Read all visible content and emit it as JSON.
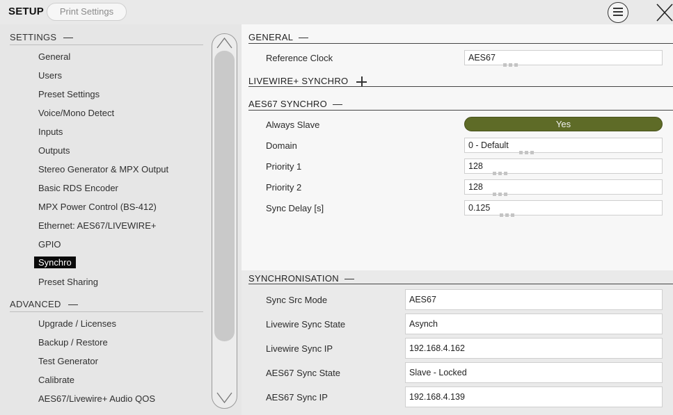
{
  "topbar": {
    "title": "SETUP",
    "print_label": "Print Settings",
    "icons": [
      "menu-icon",
      "close-icon"
    ]
  },
  "sidebar": {
    "settings_header": "SETTINGS",
    "settings_items": [
      "General",
      "Users",
      "Preset Settings",
      "Voice/Mono Detect",
      "Inputs",
      "Outputs",
      "Stereo Generator & MPX Output",
      "Basic RDS Encoder",
      "MPX Power Control (BS-412)",
      "Ethernet: AES67/LIVEWIRE+",
      "GPIO",
      "Synchro",
      "Preset Sharing"
    ],
    "active_item": "Synchro",
    "advanced_header": "ADVANCED",
    "advanced_items": [
      "Upgrade / Licenses",
      "Backup / Restore",
      "Test Generator",
      "Calibrate",
      "AES67/Livewire+ Audio QOS"
    ]
  },
  "main": {
    "general": {
      "header": "GENERAL",
      "reference_clock_label": "Reference Clock",
      "reference_clock_value": "AES67"
    },
    "livewire": {
      "header": "LIVEWIRE+ SYNCHRO"
    },
    "aes67": {
      "header": "AES67 SYNCHRO",
      "always_slave_label": "Always Slave",
      "always_slave_value": "Yes",
      "domain_label": "Domain",
      "domain_value": "0 - Default",
      "priority1_label": "Priority 1",
      "priority1_value": "128",
      "priority2_label": "Priority 2",
      "priority2_value": "128",
      "sync_delay_label": "Sync Delay [s]",
      "sync_delay_value": "0.125"
    },
    "synchronisation": {
      "header": "SYNCHRONISATION",
      "rows": [
        {
          "label": "Sync Src Mode",
          "value": "AES67"
        },
        {
          "label": "Livewire Sync State",
          "value": "Asynch"
        },
        {
          "label": "Livewire Sync IP",
          "value": "192.168.4.162"
        },
        {
          "label": "AES67 Sync State",
          "value": "Slave - Locked"
        },
        {
          "label": "AES67 Sync IP",
          "value": "192.168.4.139"
        }
      ]
    }
  },
  "colors": {
    "toggle_on": "#5e6b27",
    "active_nav_bg": "#0b0b0b"
  }
}
